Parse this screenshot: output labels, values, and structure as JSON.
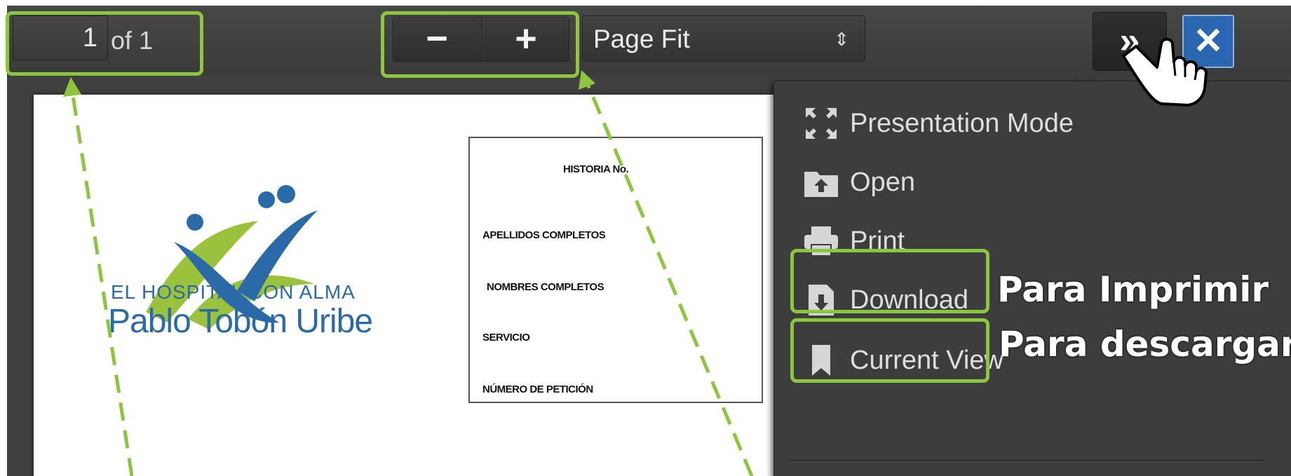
{
  "toolbar": {
    "page_number": "1",
    "page_count": "of 1",
    "zoom_out_label": "−",
    "zoom_in_label": "+",
    "scale_value": "Page Fit",
    "scale_caret": "⇕",
    "tools_toggle_label": "»",
    "close_label": "✕"
  },
  "document": {
    "logo_tagline": "EL HOSPITAL CON ALMA",
    "logo_name": "Pablo Tobón Uribe",
    "fields": {
      "historia": "HISTORIA No.",
      "apellidos": "APELLIDOS COMPLETOS",
      "nombres": "NOMBRES COMPLETOS",
      "servicio": "SERVICIO",
      "numero_peticion": "NÚMERO DE PETICIÓN"
    }
  },
  "menu": {
    "items": [
      {
        "label": "Presentation Mode",
        "icon": "presentation-mode-icon"
      },
      {
        "label": "Open",
        "icon": "folder-open-icon"
      },
      {
        "label": "Print",
        "icon": "printer-icon"
      },
      {
        "label": "Download",
        "icon": "download-icon"
      },
      {
        "label": "Current View",
        "icon": "bookmark-icon"
      }
    ]
  },
  "annotations": {
    "print_caption": "Para Imprimir",
    "download_caption": "Para descargar",
    "highlight_color": "#8cc63f"
  },
  "colors": {
    "toolbar_bg": "#3b3b3b",
    "close_button": "#2b66b0",
    "logo_blue": "#2a6aa8",
    "logo_green": "#9bc23c"
  }
}
